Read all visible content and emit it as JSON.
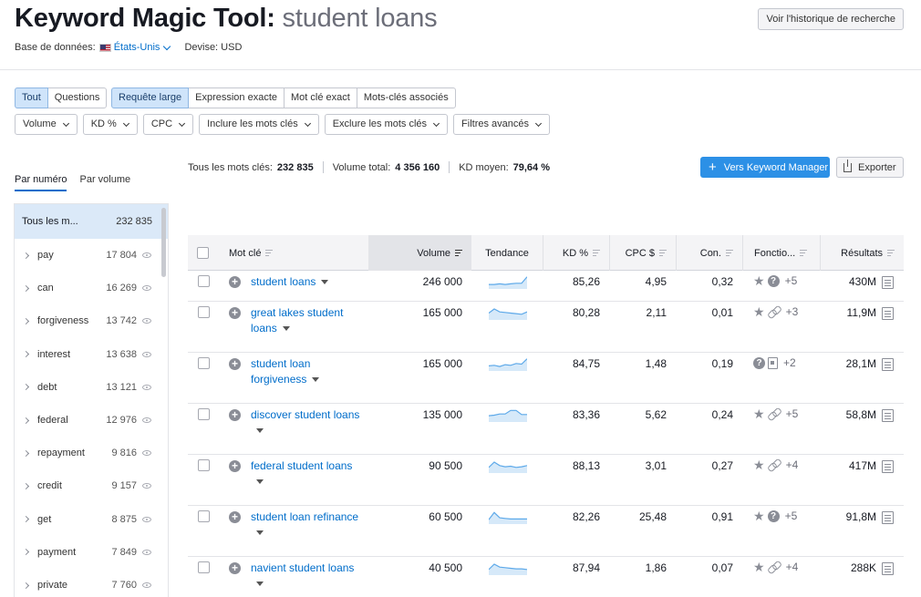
{
  "header": {
    "title_main": "Keyword Magic Tool:",
    "title_query": "student loans",
    "history_button": "Voir l'historique de recherche",
    "database_label": "Base de données:",
    "database_value": "États-Unis",
    "currency_label": "Devise: USD"
  },
  "match_tabs": [
    "Tout",
    "Questions"
  ],
  "match_types": [
    "Requête large",
    "Expression exacte",
    "Mot clé exact",
    "Mots-clés associés"
  ],
  "filters": [
    "Volume",
    "KD %",
    "CPC",
    "Inclure les mots clés",
    "Exclure les mots clés",
    "Filtres avancés"
  ],
  "sidebar": {
    "tabs": [
      "Par numéro",
      "Par volume"
    ],
    "all_label": "Tous les m...",
    "all_count": "232 835",
    "items": [
      {
        "label": "pay",
        "count": "17 804"
      },
      {
        "label": "can",
        "count": "16 269"
      },
      {
        "label": "forgiveness",
        "count": "13 742"
      },
      {
        "label": "interest",
        "count": "13 638"
      },
      {
        "label": "debt",
        "count": "13 121"
      },
      {
        "label": "federal",
        "count": "12 976"
      },
      {
        "label": "repayment",
        "count": "9 816"
      },
      {
        "label": "credit",
        "count": "9 157"
      },
      {
        "label": "get",
        "count": "8 875"
      },
      {
        "label": "payment",
        "count": "7 849"
      },
      {
        "label": "private",
        "count": "7 760"
      }
    ]
  },
  "stats": {
    "all_keywords_label": "Tous les mots clés:",
    "all_keywords_value": "232 835",
    "total_volume_label": "Volume total:",
    "total_volume_value": "4 356 160",
    "kd_label": "KD moyen:",
    "kd_value": "79,64 %"
  },
  "actions": {
    "keyword_manager": "Vers Keyword Manager",
    "export": "Exporter"
  },
  "table": {
    "headers": {
      "keyword": "Mot clé",
      "volume": "Volume",
      "trend": "Tendance",
      "kd": "KD %",
      "cpc": "CPC $",
      "com": "Con.",
      "features": "Fonctio...",
      "results": "Résultats"
    },
    "rows": [
      {
        "keyword": "student loans",
        "volume": "246 000",
        "kd": "85,26",
        "cpc": "4,95",
        "com": "0,32",
        "icons": [
          "star",
          "question"
        ],
        "more": "+5",
        "results": "430M",
        "trend": [
          0.3,
          0.3,
          0.35,
          0.3,
          0.35,
          0.4,
          0.4,
          0.95
        ]
      },
      {
        "keyword": "great lakes student loans",
        "volume": "165 000",
        "kd": "80,28",
        "cpc": "2,11",
        "com": "0,01",
        "icons": [
          "star",
          "link"
        ],
        "more": "+3",
        "results": "11,9M",
        "trend": [
          0.5,
          0.85,
          0.6,
          0.55,
          0.5,
          0.45,
          0.4,
          0.6
        ]
      },
      {
        "keyword": "student loan forgiveness",
        "volume": "165 000",
        "kd": "84,75",
        "cpc": "1,48",
        "com": "0,19",
        "icons": [
          "question",
          "doc"
        ],
        "more": "+2",
        "results": "28,1M",
        "trend": [
          0.35,
          0.4,
          0.3,
          0.45,
          0.4,
          0.55,
          0.5,
          0.95
        ]
      },
      {
        "keyword": "discover student loans",
        "volume": "135 000",
        "kd": "83,36",
        "cpc": "5,62",
        "com": "0,24",
        "icons": [
          "star",
          "link"
        ],
        "more": "+5",
        "results": "58,8M",
        "trend": [
          0.45,
          0.5,
          0.6,
          0.6,
          0.9,
          0.9,
          0.55,
          0.55
        ]
      },
      {
        "keyword": "federal student loans",
        "volume": "90 500",
        "kd": "88,13",
        "cpc": "3,01",
        "com": "0,27",
        "icons": [
          "star",
          "link"
        ],
        "more": "+4",
        "results": "417M",
        "trend": [
          0.4,
          0.85,
          0.55,
          0.45,
          0.5,
          0.4,
          0.45,
          0.55
        ]
      },
      {
        "keyword": "student loan refinance",
        "volume": "60 500",
        "kd": "82,26",
        "cpc": "25,48",
        "com": "0,91",
        "icons": [
          "star",
          "question"
        ],
        "more": "+5",
        "results": "91,8M",
        "trend": [
          0.3,
          0.9,
          0.45,
          0.4,
          0.35,
          0.35,
          0.35,
          0.35
        ]
      },
      {
        "keyword": "navient student loans",
        "volume": "40 500",
        "kd": "87,94",
        "cpc": "1,86",
        "com": "0,07",
        "icons": [
          "star",
          "link"
        ],
        "more": "+4",
        "results": "288K",
        "trend": [
          0.4,
          0.85,
          0.6,
          0.55,
          0.5,
          0.45,
          0.45,
          0.4
        ]
      }
    ]
  },
  "colors": {
    "accent": "#006dca",
    "button_primary": "#2c90e6",
    "trend_line": "#5da9e9",
    "trend_fill": "#d6e9f9",
    "selected_bg": "#cfe4fa"
  }
}
